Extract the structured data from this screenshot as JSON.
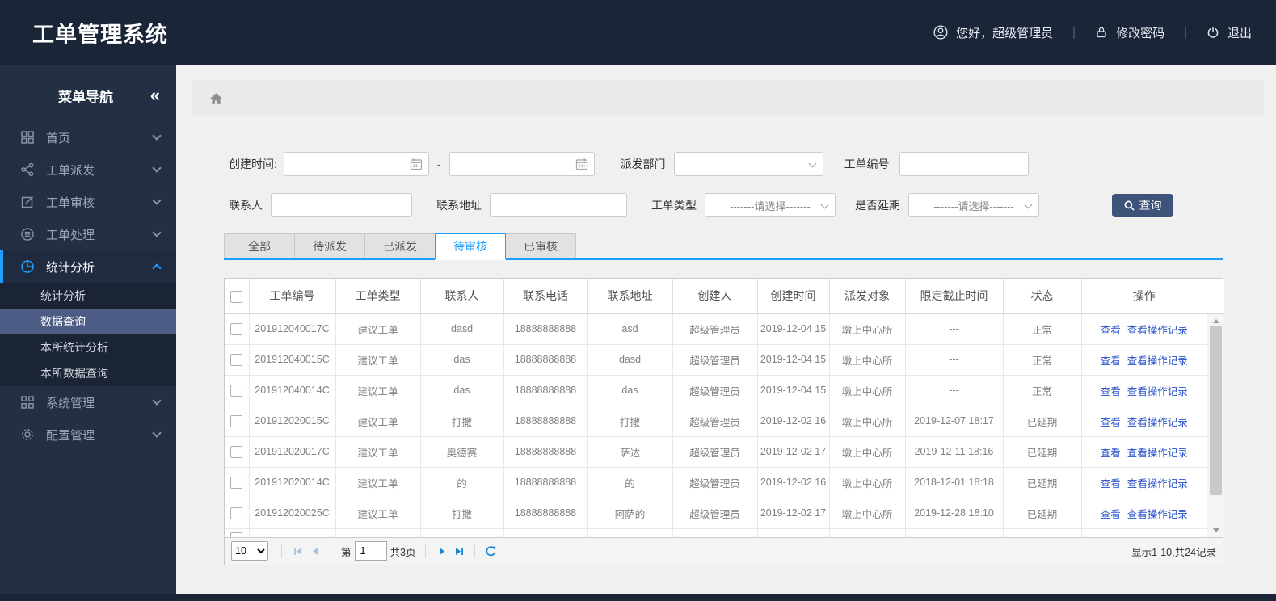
{
  "app": {
    "title": "工单管理系统"
  },
  "topbar": {
    "greeting": "您好，超级管理员",
    "change_password": "修改密码",
    "logout": "退出",
    "separator": "|"
  },
  "sidebar": {
    "title": "菜单导航",
    "collapse_icon": "«",
    "items": [
      {
        "label": "首页",
        "icon": "dashboard-icon"
      },
      {
        "label": "工单派发",
        "icon": "share-icon"
      },
      {
        "label": "工单审核",
        "icon": "edit-icon"
      },
      {
        "label": "工单处理",
        "icon": "process-icon"
      },
      {
        "label": "统计分析",
        "icon": "pie-chart-icon",
        "active": true,
        "expanded": true
      },
      {
        "label": "系统管理",
        "icon": "system-icon"
      },
      {
        "label": "配置管理",
        "icon": "gear-icon"
      }
    ],
    "submenu": {
      "parent": "统计分析",
      "items": [
        {
          "label": "统计分析",
          "selected": false
        },
        {
          "label": "数据查询",
          "selected": true
        },
        {
          "label": "本所统计分析",
          "selected": false
        },
        {
          "label": "本所数据查询",
          "selected": false
        }
      ]
    }
  },
  "filters": {
    "create_time_label": "创建时间:",
    "create_time_from": "",
    "create_time_to": "",
    "range_separator": "-",
    "dispatch_dept_label": "派发部门",
    "dispatch_dept_value": "",
    "order_no_label": "工单编号",
    "order_no_value": "",
    "contact_label": "联系人",
    "contact_value": "",
    "address_label": "联系地址",
    "address_value": "",
    "order_type_label": "工单类型",
    "order_type_value": "-------请选择-------",
    "delay_label": "是否延期",
    "delay_value": "-------请选择-------",
    "search_button": "查询"
  },
  "tabs": [
    {
      "label": "全部",
      "active": false
    },
    {
      "label": "待派发",
      "active": false
    },
    {
      "label": "已派发",
      "active": false
    },
    {
      "label": "待审核",
      "active": true
    },
    {
      "label": "已审核",
      "active": false
    }
  ],
  "table": {
    "headers": [
      "工单编号",
      "工单类型",
      "联系人",
      "联系电话",
      "联系地址",
      "创建人",
      "创建时间",
      "派发对象",
      "限定截止时间",
      "状态",
      "操作"
    ],
    "actions": [
      "查看",
      "查看操作记录"
    ],
    "rows": [
      {
        "order_no": "201912040017C",
        "type": "建议工单",
        "contact": "dasd",
        "phone": "18888888888",
        "address": "asd",
        "creator": "超级管理员",
        "created": "2019-12-04 15",
        "target": "墩上中心所",
        "deadline": "---",
        "status": "正常",
        "status_type": "normal"
      },
      {
        "order_no": "201912040015C",
        "type": "建议工单",
        "contact": "das",
        "phone": "18888888888",
        "address": "dasd",
        "creator": "超级管理员",
        "created": "2019-12-04 15",
        "target": "墩上中心所",
        "deadline": "---",
        "status": "正常",
        "status_type": "normal"
      },
      {
        "order_no": "201912040014C",
        "type": "建议工单",
        "contact": "das",
        "phone": "18888888888",
        "address": "das",
        "creator": "超级管理员",
        "created": "2019-12-04 15",
        "target": "墩上中心所",
        "deadline": "---",
        "status": "正常",
        "status_type": "normal"
      },
      {
        "order_no": "201912020015C",
        "type": "建议工单",
        "contact": "打撒",
        "phone": "18888888888",
        "address": "打撒",
        "creator": "超级管理员",
        "created": "2019-12-02 16",
        "target": "墩上中心所",
        "deadline": "2019-12-07 18:17",
        "status": "已延期",
        "status_type": "delayed"
      },
      {
        "order_no": "201912020017C",
        "type": "建议工单",
        "contact": "奥德赛",
        "phone": "18888888888",
        "address": "萨达",
        "creator": "超级管理员",
        "created": "2019-12-02 17",
        "target": "墩上中心所",
        "deadline": "2019-12-11 18:16",
        "status": "已延期",
        "status_type": "delayed"
      },
      {
        "order_no": "201912020014C",
        "type": "建议工单",
        "contact": "的",
        "phone": "18888888888",
        "address": "的",
        "creator": "超级管理员",
        "created": "2019-12-02 16",
        "target": "墩上中心所",
        "deadline": "2018-12-01 18:18",
        "status": "已延期",
        "status_type": "delayed"
      },
      {
        "order_no": "201912020025C",
        "type": "建议工单",
        "contact": "打撒",
        "phone": "18888888888",
        "address": "阿萨的",
        "creator": "超级管理员",
        "created": "2019-12-02 17",
        "target": "墩上中心所",
        "deadline": "2019-12-28 18:10",
        "status": "已延期",
        "status_type": "delayed"
      }
    ]
  },
  "pagination": {
    "page_size": "10",
    "page_prefix": "第",
    "current_page": "1",
    "total_pages": "共3页",
    "summary": "显示1-10,共24记录"
  },
  "colors": {
    "header_bg": "#1b2538",
    "sidebar_bg": "#242f44",
    "submenu_bg": "#1b2434",
    "submenu_selected_bg": "#4c5c85",
    "accent_blue": "#1e9fff",
    "search_button_bg": "#3d5379",
    "link_blue": "#2751c9",
    "status_normal": "#2751c9",
    "status_delayed": "#e01b1b",
    "pager_arrow_active": "#1685d3",
    "pager_arrow_disabled": "#a9c0d8",
    "main_bg": "#f0f0f1"
  }
}
